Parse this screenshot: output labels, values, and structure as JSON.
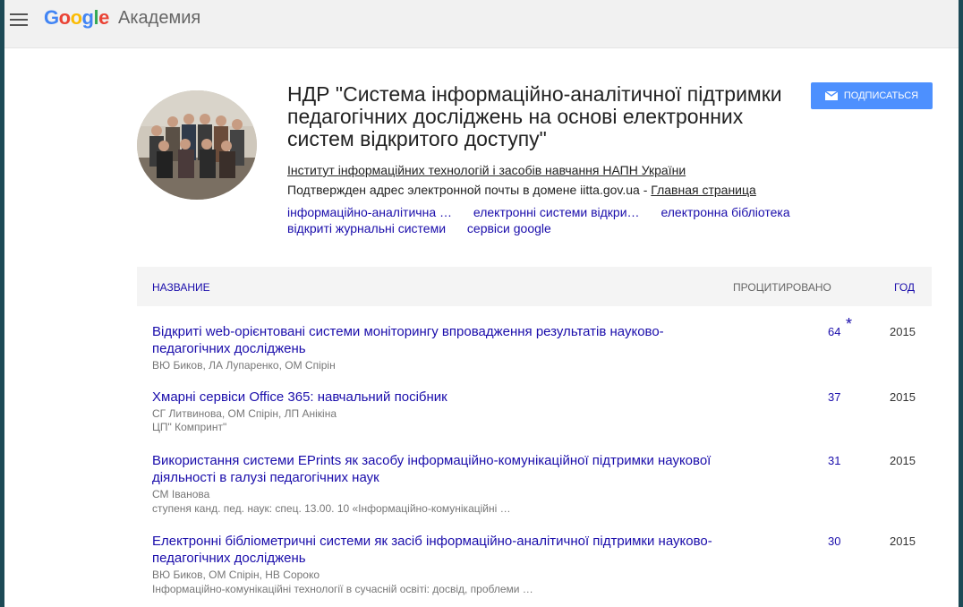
{
  "header": {
    "logo_text": "Google",
    "product_text": "Академия"
  },
  "profile": {
    "name": "НДР \"Система інформаційно-аналітичної підтримки педагогічних досліджень на основі електронних систем відкритого доступу\"",
    "affiliation": "Інститут інформаційних технологій і засобів навчання НАПН України",
    "email_text": "Подтвержден адрес электронной почты в домене iitta.gov.ua - ",
    "homepage_link": "Главная страница",
    "interests": [
      "інформаційно-аналітична …",
      "електронні системи відкри…",
      "електронна бібліотека",
      "відкриті журнальні системи",
      "сервіси google"
    ],
    "subscribe_label": "ПОДПИСАТЬСЯ"
  },
  "table": {
    "col_title": "НАЗВАНИЕ",
    "col_cited": "ПРОЦИТИРОВАНО",
    "col_year": "ГОД",
    "rows": [
      {
        "title": "Відкриті web-орієнтовані системи моніторингу впровадження результатів науково-педагогічних досліджень",
        "authors": "ВЮ Биков, ЛА Лупаренко, ОМ Спірін",
        "venue": "",
        "cited": "64",
        "star": "*",
        "year": "2015"
      },
      {
        "title": "Хмарні сервіси Office 365: навчальний посібник",
        "authors": "СГ Литвинова, ОМ Спірін, ЛП Анікіна",
        "venue": "ЦП\" Компринт\"",
        "cited": "37",
        "star": "",
        "year": "2015"
      },
      {
        "title": "Використання системи EPrints як засобу інформаційно-комунікаційної підтримки наукової діяльності в галузі педагогічних наук",
        "authors": "СМ Іванова",
        "venue": "ступеня канд. пед. наук: спец. 13.00. 10 «Інформаційно-комунікаційні …",
        "cited": "31",
        "star": "",
        "year": "2015"
      },
      {
        "title": "Електронні бібліометричні системи як засіб інформаційно-аналітичної підтримки науково-педагогічних досліджень",
        "authors": "ВЮ Биков, ОМ Спірін, НВ Сороко",
        "venue": "Інформаційно-комунікаційні технології в сучасній освіті: досвід, проблеми …",
        "cited": "30",
        "star": "",
        "year": "2015"
      }
    ]
  },
  "colors": {
    "link": "#1a0dab",
    "button": "#4d90fe",
    "background": "#1d4a56"
  }
}
